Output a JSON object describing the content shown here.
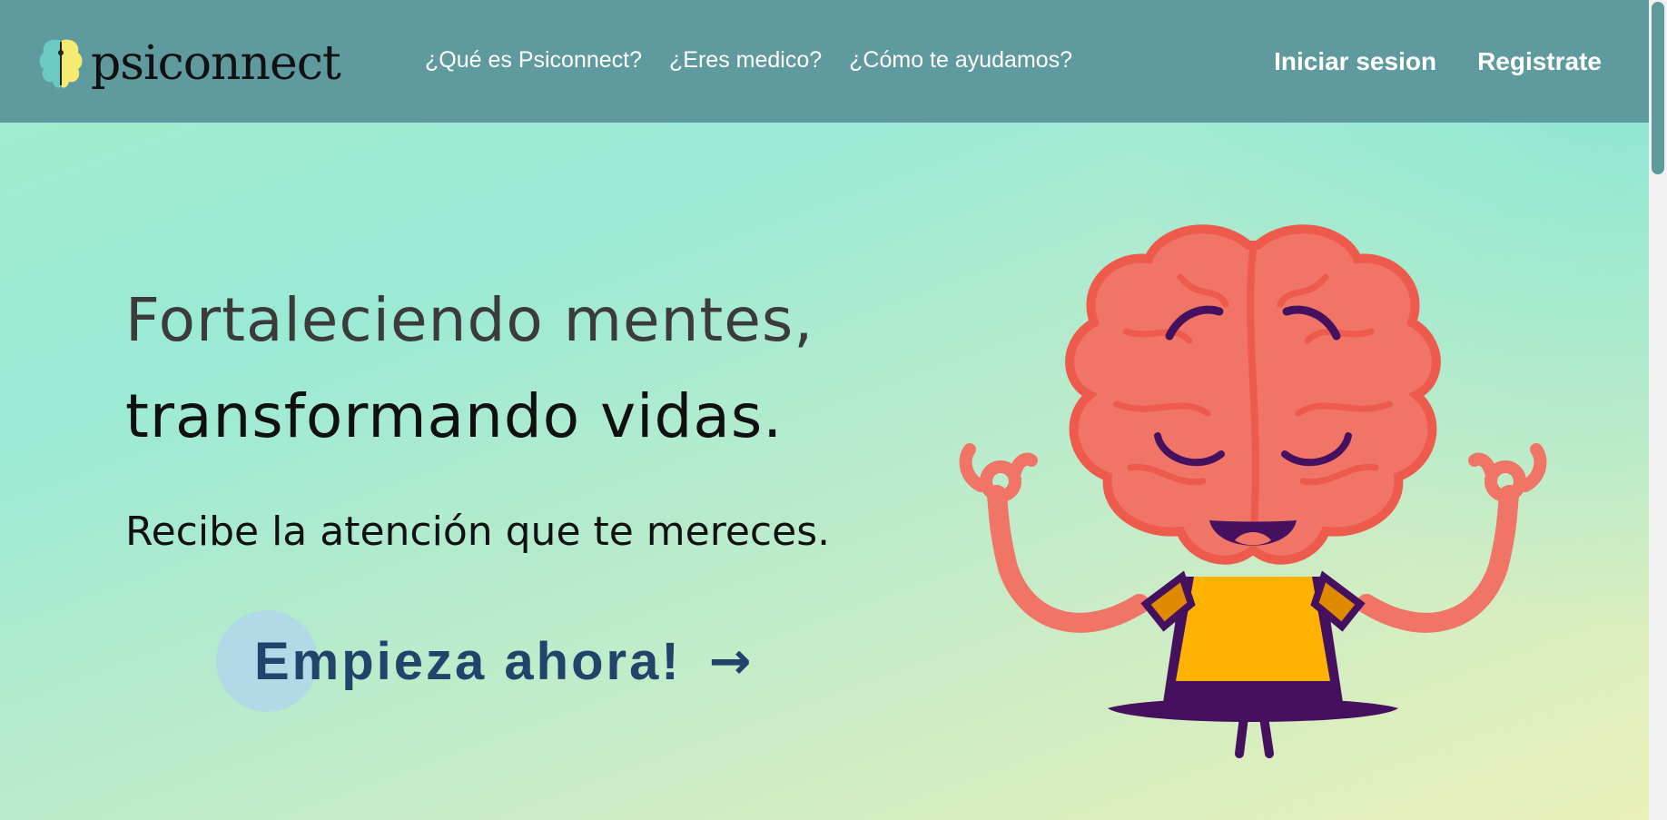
{
  "brand": {
    "name": "psiconnect",
    "logo_icon": "brain-logo-icon"
  },
  "nav": {
    "links": [
      "¿Qué es Psiconnect?",
      "¿Eres medico?",
      "¿Cómo te ayudamos?"
    ],
    "login_label": "Iniciar sesion",
    "register_label": "Registrate"
  },
  "hero": {
    "title_line1": "Fortaleciendo mentes,",
    "title_line2": "transformando vidas.",
    "subtitle": "Recibe la atención que te mereces.",
    "cta_label": "Empieza ahora!",
    "cta_arrow": "→",
    "illustration": "meditating-brain-illustration"
  },
  "colors": {
    "navbar": "#5e9a9e",
    "cta_text": "#22446a",
    "cta_circle": "#b2d9e5",
    "brain": "#f07567",
    "brain_outline": "#ee5a4c",
    "shirt": "#ffb300",
    "pants": "#45105e"
  }
}
